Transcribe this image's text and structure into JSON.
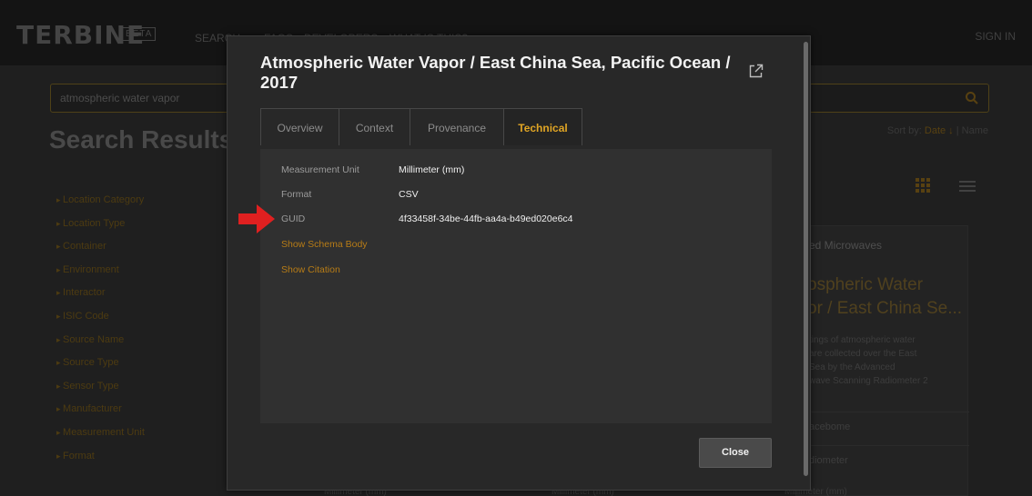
{
  "header": {
    "logo": "TERBINE",
    "beta": "BETA",
    "nav": [
      "SEARCH",
      "FAQS",
      "DEVELOPERS",
      "WHAT IS THIS?"
    ],
    "sign_in": "SIGN IN"
  },
  "search": {
    "query": "atmospheric water vapor"
  },
  "results": {
    "title": "Search Results",
    "sort_prefix": "Sort by: ",
    "sort_active": "Date ↓",
    "sort_rest": " | Name"
  },
  "facets": [
    "Location Category",
    "Location Type",
    "Container",
    "Environment",
    "Interactor",
    "ISIC Code",
    "Source Name",
    "Source Type",
    "Sensor Type",
    "Manufacturer",
    "Measurement Unit",
    "Format"
  ],
  "card": {
    "source": "ed Microwaves",
    "title_line1": "ospheric Water",
    "title_line2": "or / East China Se...",
    "desc": [
      "tings of atmospheric water",
      "are collected over the East",
      "Sea by the Advanced",
      "wave Scanning Radiometer 2"
    ],
    "row1": "acebome",
    "row2": "diometer"
  },
  "bottom_units": [
    "Millimeter (mm)",
    "Millimeter (mm)",
    "Millimeter (mm)"
  ],
  "modal": {
    "title": "Atmospheric Water Vapor / East China Sea, Pacific Ocean / 2017",
    "tabs": [
      "Overview",
      "Context",
      "Provenance",
      "Technical"
    ],
    "active_tab": "Technical",
    "fields": [
      {
        "label": "Measurement Unit",
        "value": "Millimeter (mm)"
      },
      {
        "label": "Format",
        "value": "CSV"
      },
      {
        "label": "GUID",
        "value": "4f33458f-34be-44fb-aa4a-b49ed020e6c4"
      }
    ],
    "links": [
      "Show Schema Body",
      "Show Citation"
    ],
    "close_label": "Close"
  },
  "colors": {
    "accent": "#e0a524",
    "annotation_arrow": "#e02020"
  }
}
